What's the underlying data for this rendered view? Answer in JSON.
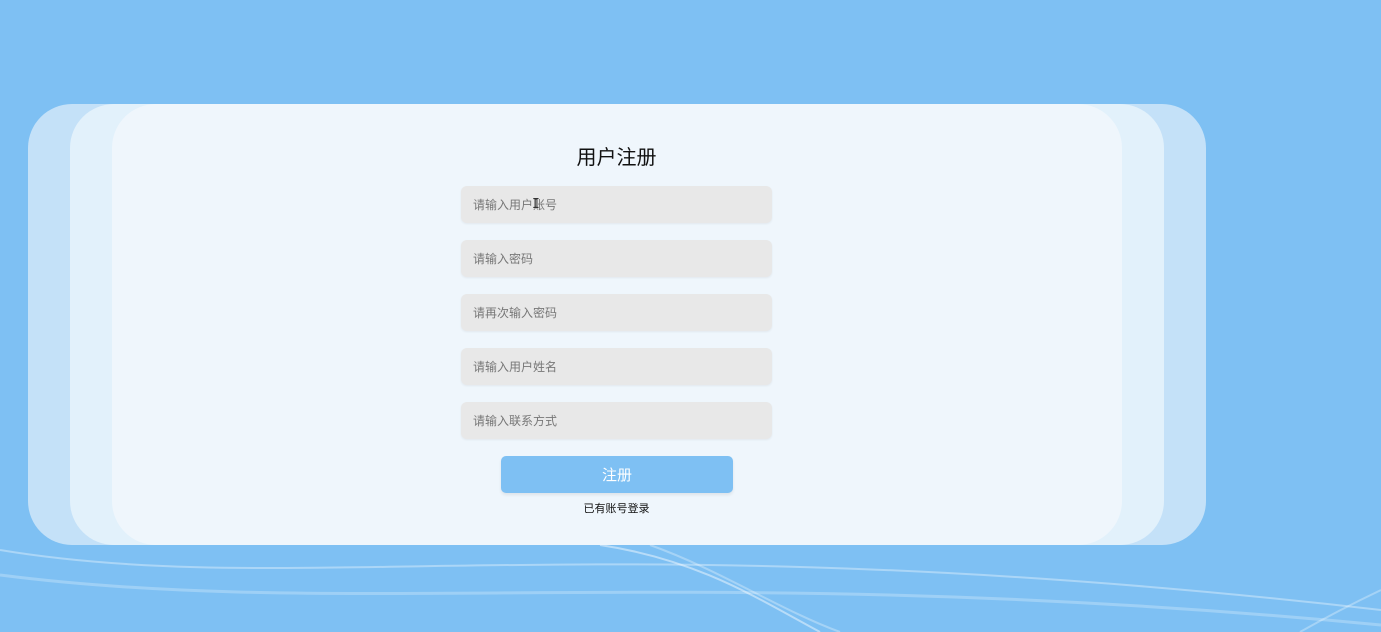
{
  "colors": {
    "background": "#7ec0f3",
    "card": "#eff6fc",
    "field_background": "#e8e8e8",
    "button": "#7ec0f3",
    "button_text": "#ffffff"
  },
  "form": {
    "title": "用户注册",
    "fields": [
      {
        "name": "username",
        "placeholder": "请输入用户账号",
        "value": ""
      },
      {
        "name": "password",
        "placeholder": "请输入密码",
        "value": ""
      },
      {
        "name": "confirm_password",
        "placeholder": "请再次输入密码",
        "value": ""
      },
      {
        "name": "real_name",
        "placeholder": "请输入用户姓名",
        "value": ""
      },
      {
        "name": "contact",
        "placeholder": "请输入联系方式",
        "value": ""
      }
    ],
    "submit_label": "注册",
    "login_link": "已有账号登录"
  },
  "cursor": {
    "icon": "text-cursor-icon"
  }
}
